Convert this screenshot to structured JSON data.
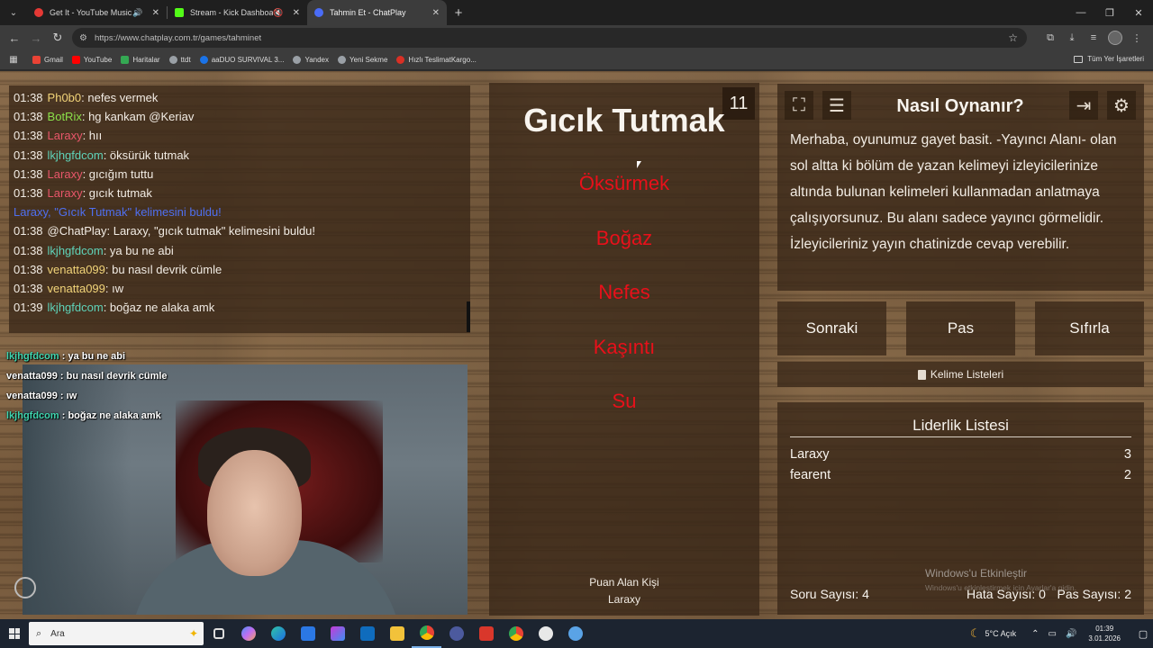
{
  "browser": {
    "tabs": [
      {
        "title": "Get It - YouTube Music",
        "fav_color": "#e53935"
      },
      {
        "title": "Stream - Kick Dashboard",
        "fav_color": "#53fc18"
      },
      {
        "title": "Tahmin Et - ChatPlay",
        "fav_color": "#4a6cf7"
      }
    ],
    "url": "https://www.chatplay.com.tr/games/tahminet",
    "bookmarks": [
      "Gmail",
      "YouTube",
      "Haritalar",
      "ttdt",
      "aaDUO SURVIVAL 3...",
      "Yandex",
      "Yeni Sekme",
      "Hızlı TeslimatKargo..."
    ],
    "bookmarks_all": "Tüm Yer İşaretleri"
  },
  "chat": {
    "lines": [
      {
        "time": "01:38",
        "user": "Ph0b0",
        "color": "#f2d479",
        "msg": ": nefes vermek"
      },
      {
        "time": "01:38",
        "user": "BotRix",
        "color": "#8be04a",
        "msg": ": hg kankam @Keriav"
      },
      {
        "time": "01:38",
        "user": "Laraxy",
        "color": "#e8566a",
        "msg": ": hıı"
      },
      {
        "time": "01:38",
        "user": "lkjhgfdcom",
        "color": "#5fd3b9",
        "msg": ": öksürük tutmak"
      },
      {
        "time": "01:38",
        "user": "Laraxy",
        "color": "#e8566a",
        "msg": ": gıcığım tuttu"
      },
      {
        "time": "01:38",
        "user": "Laraxy",
        "color": "#e8566a",
        "msg": ": gıcık tutmak"
      },
      {
        "time": "",
        "user": "",
        "color": "#4f6ff0",
        "msg": "Laraxy, \"Gıcık Tutmak\" kelimesini buldu!"
      },
      {
        "time": "01:38",
        "user": "@ChatPlay",
        "color": "#f2ece4",
        "msg": ": Laraxy, \"gıcık tutmak\" kelimesini buldu!"
      },
      {
        "time": "01:38",
        "user": "lkjhgfdcom",
        "color": "#5fd3b9",
        "msg": ": ya bu ne abi"
      },
      {
        "time": "01:38",
        "user": "venatta099",
        "color": "#f2d479",
        "msg": ": bu nasıl devrik cümle"
      },
      {
        "time": "01:38",
        "user": "venatta099",
        "color": "#f2d479",
        "msg": ": ıw"
      },
      {
        "time": "01:39",
        "user": "lkjhgfdcom",
        "color": "#5fd3b9",
        "msg": ": boğaz ne alaka amk"
      }
    ]
  },
  "overlay_chat": [
    {
      "user": "lkjhgfdcom",
      "color": "#3fd6b0",
      "msg": " : ya bu ne abi"
    },
    {
      "user": "venatta099",
      "color": "#ffffff",
      "msg": " : bu nasıl devrik cümle"
    },
    {
      "user": "venatta099",
      "color": "#ffffff",
      "msg": " : ıw"
    },
    {
      "user": "lkjhgfdcom",
      "color": "#3fd6b0",
      "msg": " : boğaz ne alaka amk"
    }
  ],
  "game": {
    "question_number": "11",
    "word": "Gıcık Tutmak",
    "taboo_words": [
      "Öksürmek",
      "Boğaz",
      "Nefes",
      "Kaşıntı",
      "Su"
    ],
    "scorer_label": "Puan Alan Kişi",
    "scorer_name": "Laraxy"
  },
  "howto": {
    "title": "Nasıl Oynanır?",
    "text": "Merhaba, oyunumuz gayet basit. -Yayıncı Alanı- olan sol altta ki bölüm de yazan kelimeyi izleyicilerinize altında bulunan kelimeleri kullanmadan anlatmaya çalışıyorsunuz. Bu alanı sadece yayıncı görmelidir. İzleyicileriniz yayın chatinizde cevap verebilir."
  },
  "actions": {
    "next": "Sonraki",
    "pass": "Pas",
    "reset": "Sıfırla",
    "word_lists": "Kelime Listeleri"
  },
  "leaderboard": {
    "title": "Liderlik Listesi",
    "rows": [
      {
        "name": "Laraxy",
        "score": "3"
      },
      {
        "name": "fearent",
        "score": "2"
      }
    ]
  },
  "stats": {
    "questions": "Soru Sayısı: 4",
    "errors": "Hata Sayısı: 0",
    "passes": "Pas Sayısı: 2"
  },
  "watermark": {
    "line1": "Windows'u Etkinleştir",
    "line2": "Windows'u etkinleştirmek için Ayarlar'a gidin."
  },
  "taskbar": {
    "search_placeholder": "Ara",
    "weather": "5°C  Açık",
    "time": "01:39",
    "date": "3.01.2026"
  }
}
